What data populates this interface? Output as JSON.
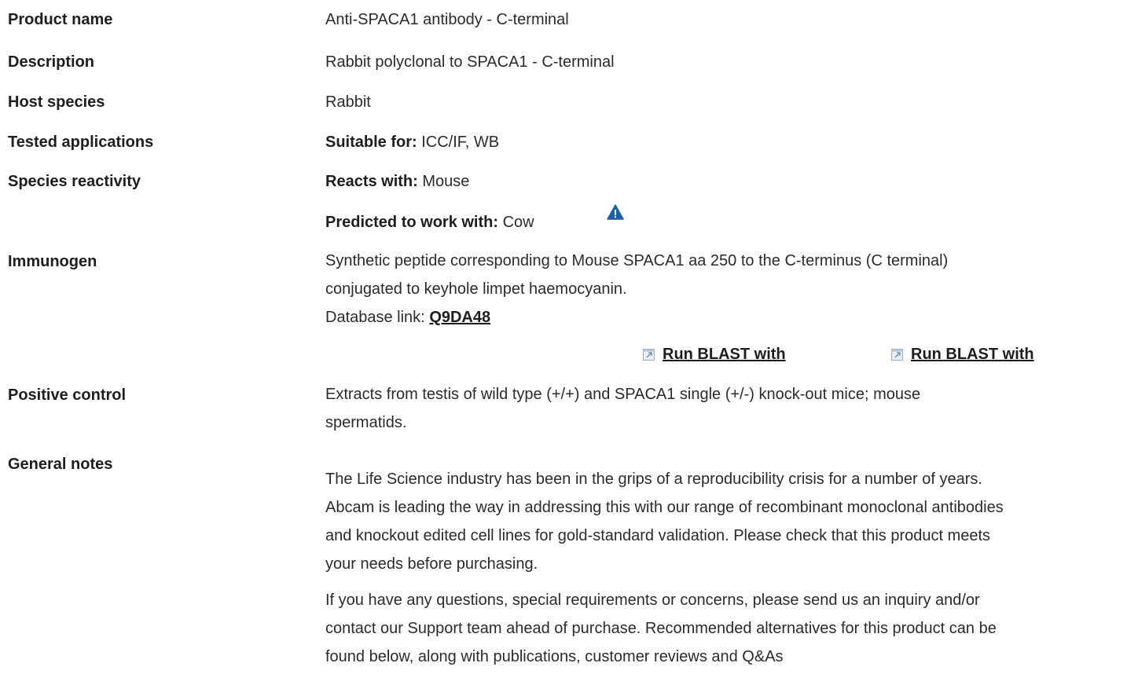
{
  "rows": {
    "product_name": {
      "label": "Product name",
      "value": "Anti-SPACA1 antibody - C-terminal"
    },
    "description": {
      "label": "Description",
      "value": "Rabbit polyclonal to SPACA1 - C-terminal"
    },
    "host_species": {
      "label": "Host species",
      "value": "Rabbit"
    },
    "tested_applications": {
      "label": "Tested applications",
      "key": "Suitable for:",
      "value": "ICC/IF, WB"
    },
    "species_reactivity": {
      "label": "Species reactivity",
      "reacts_key": "Reacts with:",
      "reacts_value": "Mouse",
      "predicted_key": "Predicted to work with:",
      "predicted_value": "Cow"
    },
    "immunogen": {
      "label": "Immunogen",
      "line1": "Synthetic peptide corresponding to Mouse SPACA1 aa 250 to the C-terminus (C terminal)",
      "line2": "conjugated to keyhole limpet haemocyanin.",
      "db_prefix": "Database link:",
      "db_link": "Q9DA48",
      "blast_1": "Run BLAST with",
      "blast_2": "Run BLAST with"
    },
    "positive_control": {
      "label": "Positive control",
      "line1": "Extracts from testis of wild type (+/+) and SPACA1 single (+/-) knock-out mice; mouse",
      "line2": "spermatids."
    },
    "general_notes": {
      "label": "General notes",
      "p1_l1": "The Life Science industry has been in the grips of a reproducibility crisis for a number of years.",
      "p1_l2": "Abcam is leading the way in addressing this with our range of recombinant monoclonal antibodies",
      "p1_l3": "and knockout edited cell lines for gold-standard validation. Please check that this product meets",
      "p1_l4": "your needs before purchasing.",
      "p2_l1": "If you have any questions, special requirements or concerns, please send us an inquiry and/or",
      "p2_l2": "contact our Support team ahead of purchase. Recommended alternatives for this product can be",
      "p2_l3": "found below, along with publications, customer reviews and Q&As"
    }
  },
  "colors": {
    "warning_icon": "#1f5fa8",
    "link": "#1e1e1e"
  },
  "icons": {
    "warning": "warning-triangle-icon",
    "external": "external-link-icon"
  }
}
